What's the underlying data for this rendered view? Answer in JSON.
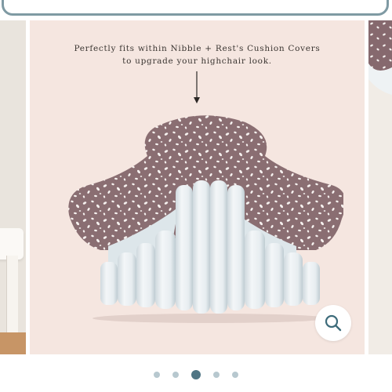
{
  "caption": {
    "line1": "Perfectly fits within Nibble + Rest's Cushion Covers",
    "line2": "to upgrade your highchair look."
  },
  "icons": {
    "arrow": "arrow-down-icon",
    "zoom": "search-icon"
  },
  "product": {
    "image": "inflatable-highchair-cushion-insert-on-speckled-mauve-cover"
  },
  "pagination": {
    "total": 5,
    "active_index": 2
  },
  "colors": {
    "slide_background": "#f5e6e0",
    "cover_mauve": "#8a6e72",
    "cushion_white": "#eef2f4",
    "zoom_icon": "#3d6b7a",
    "active_dot": "#4f7584",
    "inactive_dot": "#b7c8cf",
    "search_border": "#7f9aa3"
  }
}
